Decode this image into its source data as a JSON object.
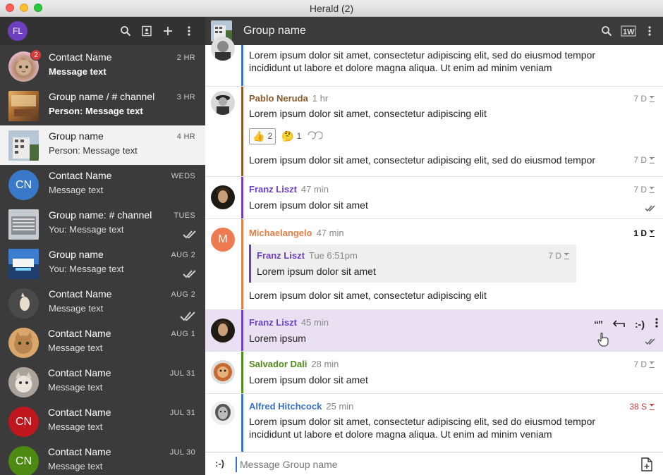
{
  "window": {
    "title": "Herald (2)"
  },
  "colors": {
    "sidebar": "#3b3b3b",
    "accent_purple": "#6b3ec3",
    "red": "#c8383b"
  },
  "sidebar": {
    "me_initials": "FL",
    "header_icons": [
      "search-icon",
      "contacts-icon",
      "add-icon",
      "more-icon"
    ],
    "conversations": [
      {
        "name": "Contact Name",
        "message": "Message text",
        "time": "2 HR",
        "badge": "2",
        "bold": true
      },
      {
        "name": "Group name  /  # channel",
        "message": "Person: Message text",
        "time": "3 HR",
        "bold": true
      },
      {
        "name": "Group name",
        "message": "Person: Message text",
        "time": "4 HR",
        "selected": true
      },
      {
        "name": "Contact Name",
        "message": "Message text",
        "time": "WEDS",
        "initials": "CN"
      },
      {
        "name": "Group name:  # channel",
        "message": "You: Message text",
        "time": "TUES"
      },
      {
        "name": "Group name",
        "message": "You: Message text",
        "time": "AUG 2"
      },
      {
        "name": "Contact Name",
        "message": "Message text",
        "time": "AUG 2"
      },
      {
        "name": "Contact Name",
        "message": "Message text",
        "time": "AUG 1"
      },
      {
        "name": "Contact Name",
        "message": "Message text",
        "time": "JUL 31"
      },
      {
        "name": "Contact Name",
        "message": "Message text",
        "time": "JUL 31",
        "initials": "CN"
      },
      {
        "name": "Contact Name",
        "message": "Message text",
        "time": "JUL 30",
        "initials": "CN"
      }
    ]
  },
  "chat": {
    "title": "Group name",
    "header_icons": [
      "search-icon",
      "1w-icon",
      "more-icon"
    ],
    "messages": [
      {
        "body": "Lorem ipsum dolor sit amet, consectetur adipiscing elit, sed do eiusmod tempor incididunt ut labore et dolore magna aliqua. Ut enim ad minim veniam"
      },
      {
        "sender": "Pablo Neruda",
        "ago": "1 hr",
        "body": "Lorem ipsum dolor sit amet, consectetur adipiscing elit",
        "expiry": "7 D",
        "reaction_count": "2",
        "reaction2_count": "1",
        "body2": "Lorem ipsum dolor sit amet, consectetur adipiscing elit, sed do eiusmod tempor",
        "expiry2": "7 D"
      },
      {
        "sender": "Franz Liszt",
        "ago": "47 min",
        "body": "Lorem ipsum dolor sit amet",
        "expiry": "7 D"
      },
      {
        "sender": "Michaelangelo",
        "ago": "47 min",
        "initial": "M",
        "quote_sender": "Franz Liszt",
        "quote_ago": "Tue 6:51pm",
        "quote_expiry": "7 D",
        "quote_body": "Lorem ipsum dolor sit amet",
        "body": "Lorem ipsum dolor sit amet, consectetur adipiscing elit",
        "expiry": "1 D"
      },
      {
        "sender": "Franz Liszt",
        "ago": "45 min",
        "body": "Lorem ipsum",
        "tools": [
          "“”",
          "↩",
          ":-)",
          "⋮"
        ]
      },
      {
        "sender": "Salvador Dali",
        "ago": "28 min",
        "body": "Lorem ipsum dolor sit amet",
        "expiry": "7 D"
      },
      {
        "sender": "Alfred Hitchcock",
        "ago": "25 min",
        "body": "Lorem ipsum dolor sit amet, consectetur adipiscing elit, sed do eiusmod tempor incididunt ut labore et dolore magna aliqua. Ut enim ad minim veniam",
        "expiry": "38 S"
      }
    ],
    "composer": {
      "emoji": ":-)",
      "placeholder": "Message Group name"
    }
  }
}
